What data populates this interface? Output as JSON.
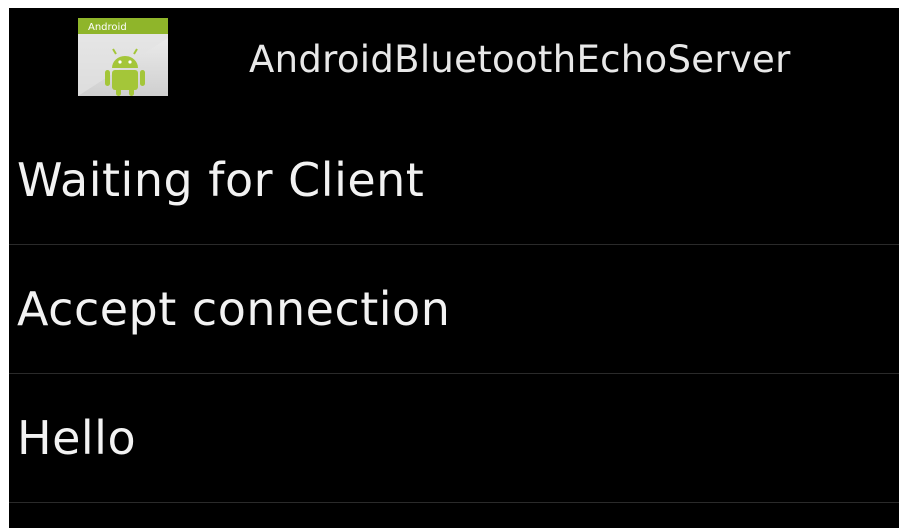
{
  "app": {
    "title": "AndroidBluetoothEchoServer",
    "icon_name": "android-app-icon",
    "icon_label": "Android"
  },
  "messages": [
    {
      "text": "Waiting for Client"
    },
    {
      "text": "Accept connection"
    },
    {
      "text": "Hello"
    }
  ],
  "colors": {
    "background": "#000000",
    "text": "#f2f2f2",
    "divider": "#2a2a2a",
    "android_green": "#a4c639"
  }
}
